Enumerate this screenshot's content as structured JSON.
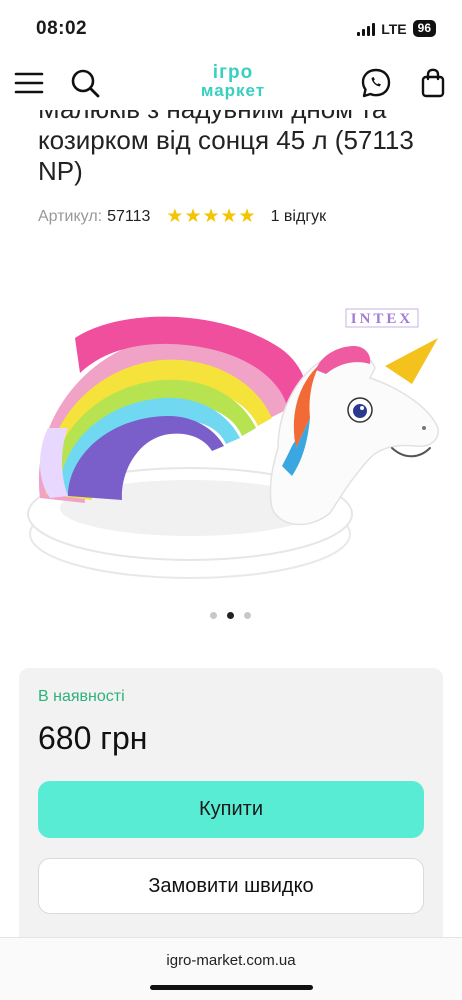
{
  "status_bar": {
    "time": "08:02",
    "network": "LTE",
    "battery": "96"
  },
  "header": {
    "logo_line1": "ігро",
    "logo_line2": "маркет",
    "icons": [
      "menu-icon",
      "search-icon",
      "chat-phone-icon",
      "shopping-bag-icon"
    ]
  },
  "product": {
    "title": "Малюків з надувним дном та козирком від сонця 45 л (57113 NP)",
    "article_label": "Артикул:",
    "article_value": "57113",
    "stars": "★★★★★",
    "rating": 5,
    "reviews": "1 відгук",
    "image_brand": "INTEX",
    "carousel": {
      "count": 3,
      "active": 2
    }
  },
  "buybox": {
    "availability": "В наявності",
    "price": "680 грн",
    "buy_label": "Купити",
    "quick_order_label": "Замовити швидко"
  },
  "browser": {
    "url": "igro-market.com.ua"
  },
  "colors": {
    "accent": "#57ecd3",
    "logo": "#39cfc1",
    "in_stock": "#2ab37a",
    "star": "#f5c400"
  }
}
